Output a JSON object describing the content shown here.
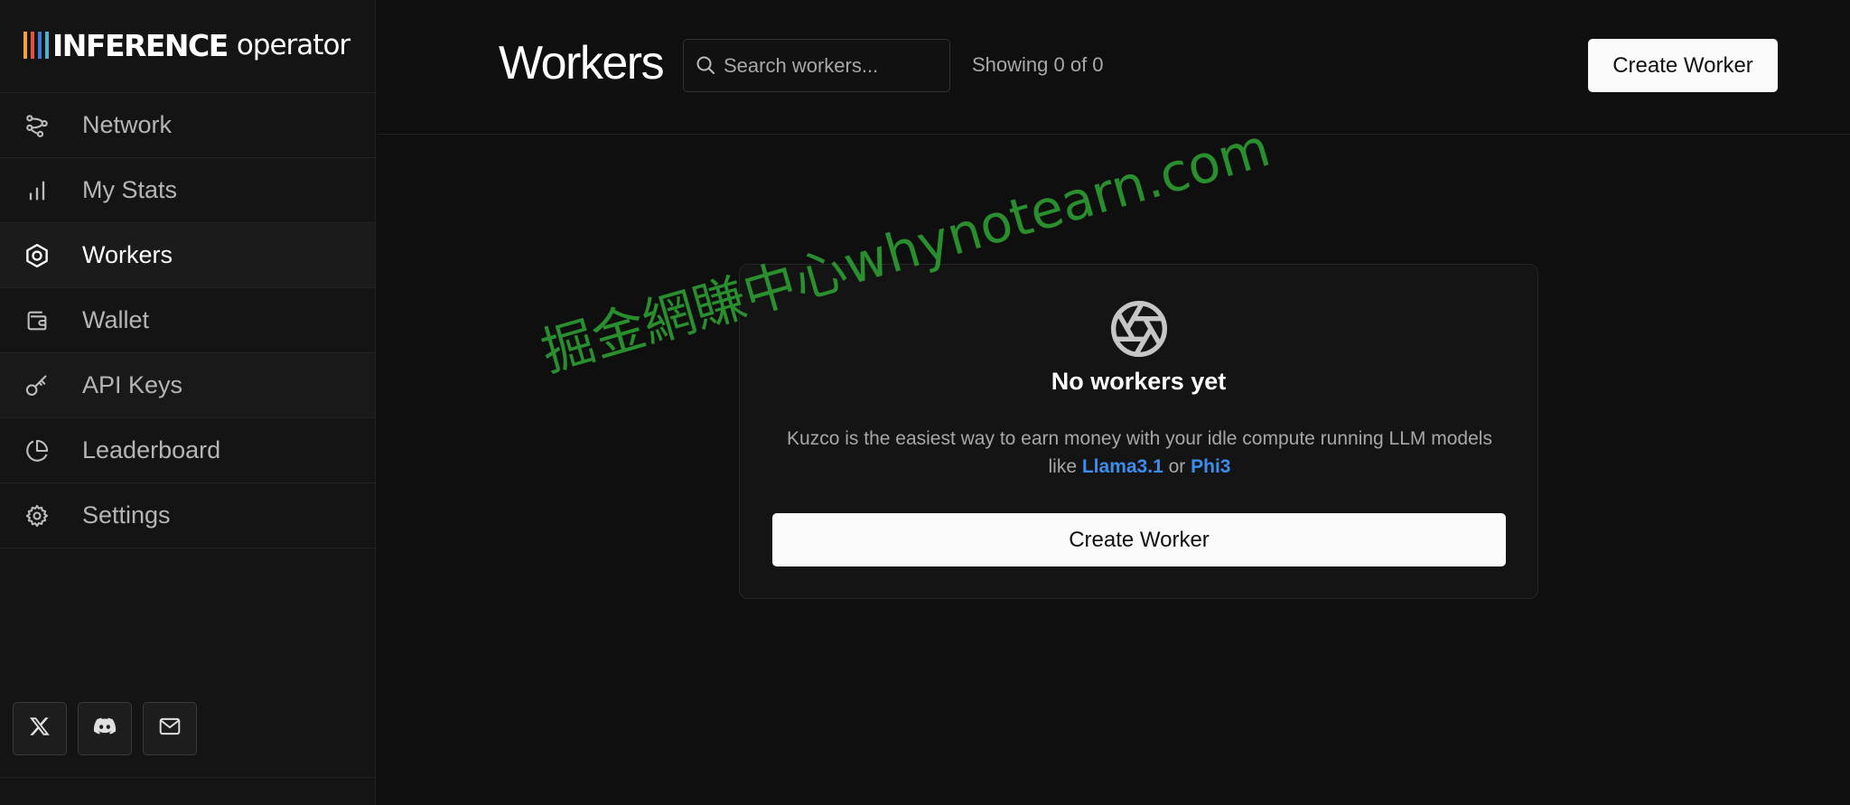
{
  "logo": {
    "brand": "INFERENCE",
    "sub": "operator",
    "bar_colors": [
      "#f2a33a",
      "#e5533d",
      "#3a7bd5",
      "#4fb0c6"
    ]
  },
  "sidebar": {
    "items": [
      {
        "label": "Network",
        "icon": "network-icon"
      },
      {
        "label": "My Stats",
        "icon": "bar-chart-icon"
      },
      {
        "label": "Workers",
        "icon": "hexagon-icon"
      },
      {
        "label": "Wallet",
        "icon": "wallet-icon"
      },
      {
        "label": "API Keys",
        "icon": "key-icon"
      },
      {
        "label": "Leaderboard",
        "icon": "pie-chart-icon"
      },
      {
        "label": "Settings",
        "icon": "gear-icon"
      }
    ],
    "active_index": 2,
    "socials": [
      "x-icon",
      "discord-icon",
      "mail-icon"
    ]
  },
  "header": {
    "title": "Workers",
    "search_placeholder": "Search workers...",
    "showing": "Showing 0 of 0",
    "create_label": "Create Worker"
  },
  "empty_state": {
    "icon": "aperture-icon",
    "title": "No workers yet",
    "desc_before": "Kuzco is the easiest way to earn money with your idle compute running LLM models like",
    "link1": "Llama3.1",
    "desc_mid": "or",
    "link2": "Phi3",
    "create_label": "Create Worker"
  },
  "watermark": "掘金網賺中心whynotearn.com",
  "colors": {
    "link": "#3b8ef0",
    "watermark": "#2ea032"
  }
}
